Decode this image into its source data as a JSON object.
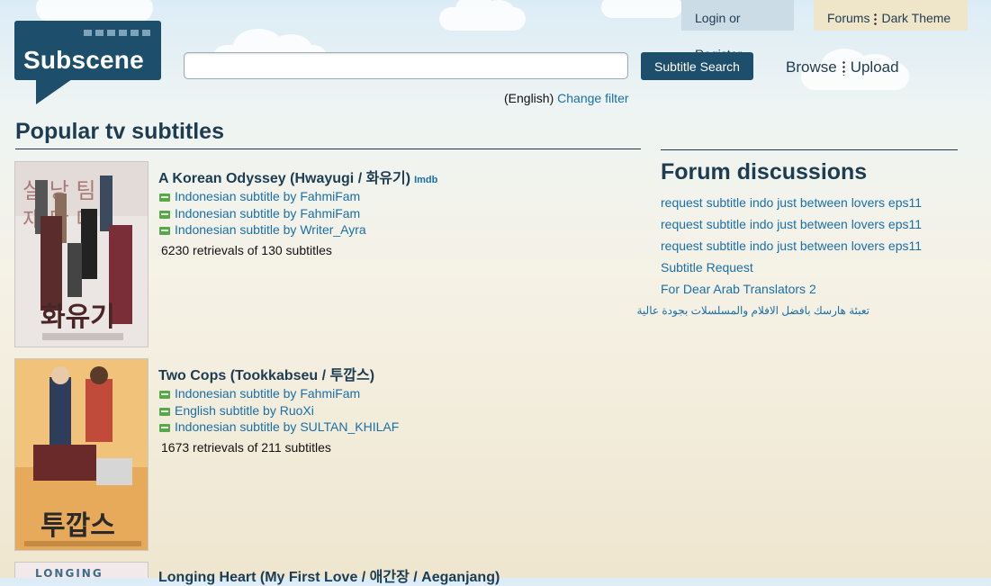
{
  "header": {
    "logo_text": "Subscene",
    "search_placeholder": "",
    "search_button": "Subtitle Search",
    "filter_language": "(English)",
    "filter_link": "Change filter",
    "nav": {
      "browse": "Browse",
      "upload": "Upload"
    },
    "top_tabs": {
      "login": "Login or Register",
      "forums": "Forums",
      "dark_theme": "Dark Theme"
    }
  },
  "popular": {
    "title": "Popular tv subtitles",
    "shows": [
      {
        "title": "A Korean Odyssey (Hwayugi / 화유기)",
        "imdb": "Imdb",
        "poster_text": "화유기",
        "subtitles": [
          "Indonesian subtitle by FahmiFam",
          "Indonesian subtitle by FahmiFam",
          "Indonesian subtitle by Writer_Ayra"
        ],
        "stats": "6230 retrievals of 130 subtitles"
      },
      {
        "title": "Two Cops (Tookkabseu / 투깝스)",
        "poster_text": "투깝스",
        "subtitles": [
          "Indonesian subtitle by FahmiFam",
          "English subtitle by RuoXi",
          "Indonesian subtitle by SULTAN_KHILAF"
        ],
        "stats": "1673 retrievals of 211 subtitles"
      },
      {
        "title": "Longing Heart (My First Love / 애간장 / Aeganjang)",
        "poster_text": "LONGING"
      }
    ]
  },
  "forum": {
    "title": "Forum discussions",
    "links": [
      "request subtitle indo just between lovers eps11",
      "request subtitle indo just between lovers eps11",
      "request subtitle indo just between lovers eps11",
      "Subtitle Request",
      "For Dear Arab Translators 2",
      "تعبئة هارسك بافضل الافلام والمسلسلات بجودة عالية"
    ]
  },
  "colors": {
    "brand": "#1d4e6b",
    "link": "#1a6fa8",
    "subtitle_icon": "#58a84b"
  }
}
